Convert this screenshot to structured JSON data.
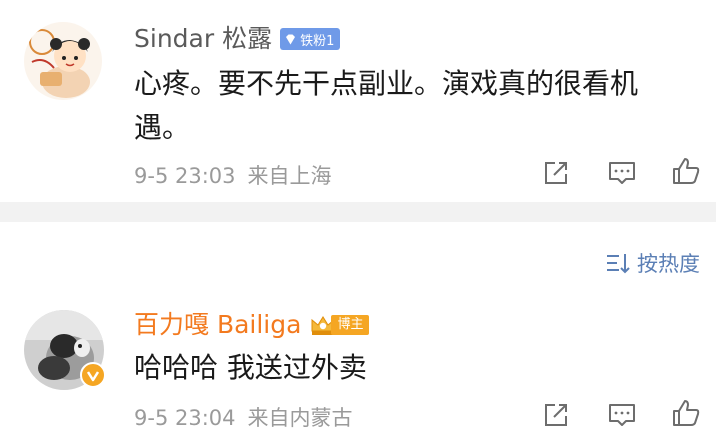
{
  "comments": [
    {
      "username": "Sindar 松露",
      "badge": "铁粉1",
      "text": "心疼。要不先干点副业。演戏真的很看机遇。",
      "time": "9-5 23:03",
      "location": "来自上海"
    },
    {
      "username": "百力嘎 Bailiga",
      "badge": "博主",
      "text": "哈哈哈 我送过外卖",
      "time": "9-5 23:04",
      "location": "来自内蒙古"
    }
  ],
  "sort": {
    "label": "按热度",
    "icon": "sort-lines-icon"
  },
  "icons": [
    "share-icon",
    "comment-icon",
    "like-icon",
    "verified-icon",
    "crown-icon",
    "diamond-icon"
  ],
  "colors": {
    "link_blue": "#5b7fb5",
    "fan_badge": "#6f9ae8",
    "host_orange": "#f37a1f",
    "verified_gold": "#f5a623",
    "divider": "#f2f2f2"
  }
}
